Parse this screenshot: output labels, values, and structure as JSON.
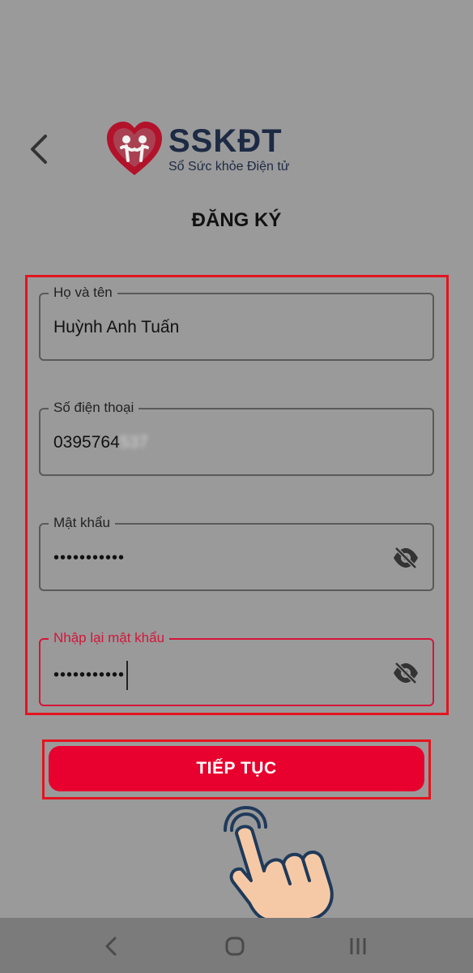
{
  "logo": {
    "title": "SSKĐT",
    "subtitle": "Sổ Sức khỏe Điện tử"
  },
  "page": {
    "title": "ĐĂNG KÝ"
  },
  "form": {
    "full_name": {
      "label": "Họ và tên",
      "value": "Huỳnh Anh Tuấn"
    },
    "phone": {
      "label": "Số điện thoại",
      "value": "0395764",
      "hidden_suffix": "537"
    },
    "password": {
      "label": "Mật khẩu",
      "value": "•••••••••••"
    },
    "confirm_password": {
      "label": "Nhập lại mật khẩu",
      "value": "•••••••••••"
    }
  },
  "continue_button": {
    "label": "TIẾP TỤC"
  },
  "colors": {
    "accent": "#e8002e",
    "highlight": "#e3141f",
    "active_field": "#d3163a",
    "background": "#9a9a9a"
  },
  "icons": [
    "back-arrow-icon",
    "heart-logo-icon",
    "eye-slash-icon",
    "tap-hand-icon",
    "nav-back-icon",
    "nav-home-icon",
    "nav-recents-icon"
  ]
}
